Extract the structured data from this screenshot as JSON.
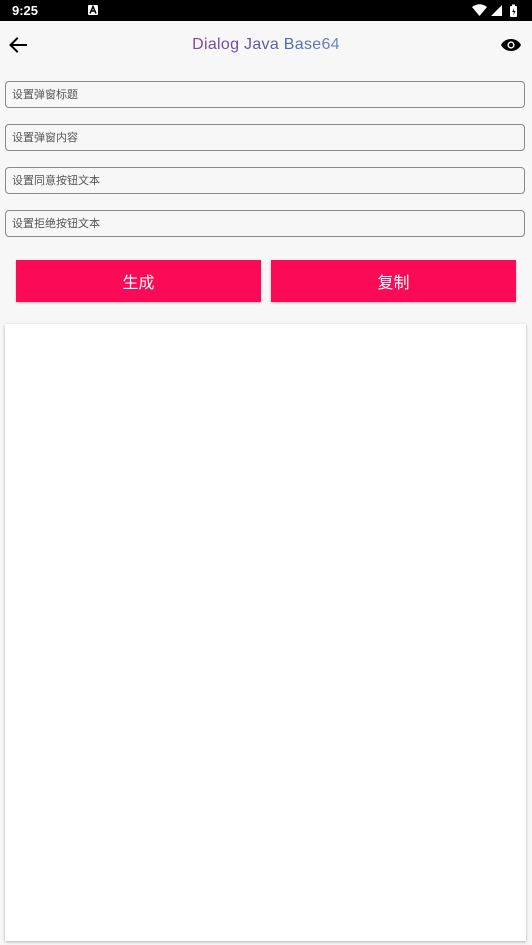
{
  "status_bar": {
    "time": "9:25",
    "notification_icon": "a-icon",
    "right_icons": [
      "wifi-icon",
      "signal-icon",
      "battery-icon"
    ]
  },
  "app_bar": {
    "title": "Dialog Java Base64",
    "back_icon": "arrow-back-icon",
    "action_icon": "eye-icon"
  },
  "form": {
    "title_placeholder": "设置弹窗标题",
    "content_placeholder": "设置弹窗内容",
    "agree_placeholder": "设置同意按钮文本",
    "reject_placeholder": "设置拒绝按钮文本"
  },
  "buttons": {
    "generate_label": "生成",
    "copy_label": "复制"
  },
  "colors": {
    "accent": "#fb0a57",
    "status_bar": "#000000",
    "background": "#f7f7f7",
    "panel": "#ffffff"
  }
}
